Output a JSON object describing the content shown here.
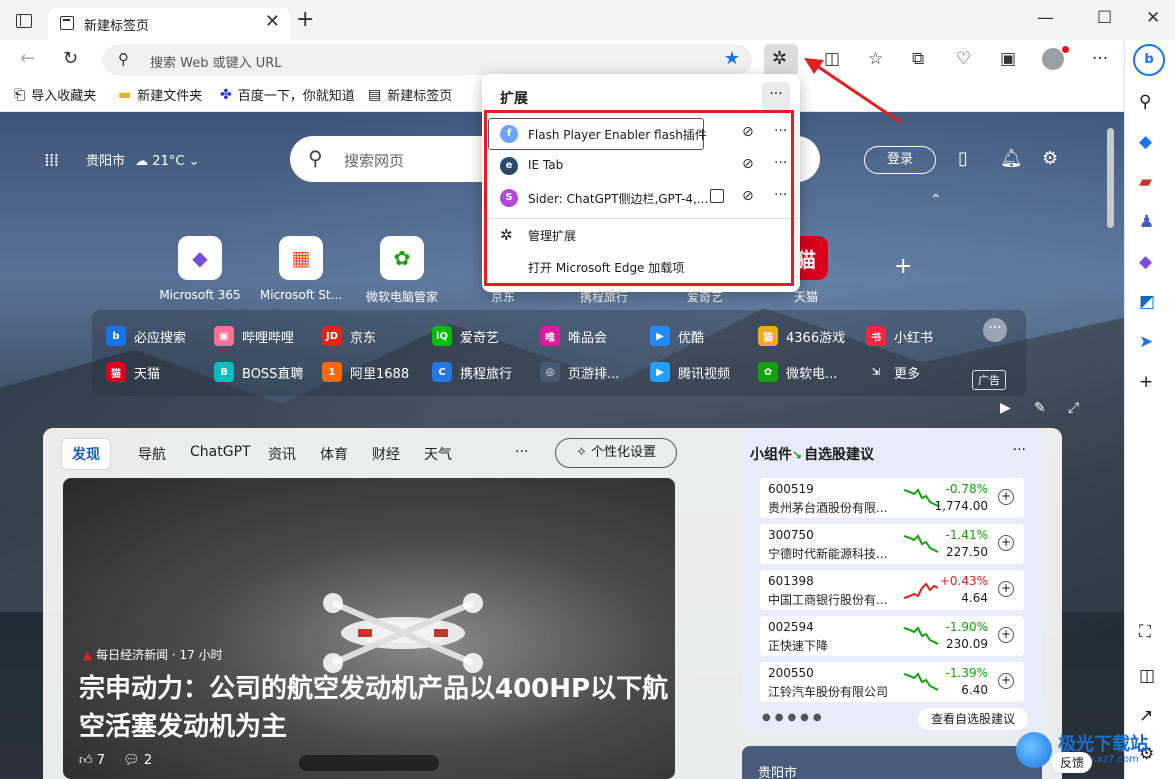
{
  "titlebar": {
    "tab_title": "新建标签页",
    "close_glyph": "✕",
    "new_tab_glyph": "+",
    "minimize": "—",
    "maximize": "☐",
    "close_window": "✕"
  },
  "addressbar": {
    "placeholder": "搜索 Web 或键入 URL"
  },
  "favorites": [
    {
      "label": "导入收藏夹",
      "icon": "import-icon"
    },
    {
      "label": "新建文件夹",
      "icon": "folder-icon"
    },
    {
      "label": "百度一下，你就知道",
      "icon": "baidu-icon"
    },
    {
      "label": "新建标签页",
      "icon": "page-icon"
    }
  ],
  "scene": {
    "city": "贵阳市",
    "temperature": "21°C",
    "search_placeholder": "搜索网页",
    "login": "登录"
  },
  "quick_links": [
    {
      "label": "Microsoft 365",
      "glyph": "◆",
      "color": "#7a4dd8"
    },
    {
      "label": "Microsoft St...",
      "glyph": "▦",
      "color": "#f35325"
    },
    {
      "label": "微软电脑管家",
      "glyph": "✿",
      "color": "#13a10e"
    },
    {
      "label": "京东",
      "glyph": "J",
      "color": "#e1251b"
    },
    {
      "label": "携程旅行",
      "glyph": "C",
      "color": "#2577e3"
    },
    {
      "label": "爱奇艺",
      "glyph": "i",
      "color": "#00be06"
    },
    {
      "label": "天猫",
      "glyph": "猫",
      "color": "#d9001b"
    }
  ],
  "link_strip": {
    "row1": [
      {
        "label": "必应搜索",
        "bg": "#1a73e8",
        "t": "b"
      },
      {
        "label": "哔哩哔哩",
        "bg": "#fb7299",
        "t": "▣"
      },
      {
        "label": "京东",
        "bg": "#e1251b",
        "t": "JD"
      },
      {
        "label": "爱奇艺",
        "bg": "#00be06",
        "t": "iQ"
      },
      {
        "label": "唯品会",
        "bg": "#e2199f",
        "t": "唯"
      },
      {
        "label": "优酷",
        "bg": "#1f8bff",
        "t": "▶"
      },
      {
        "label": "4366游戏",
        "bg": "#f4a91e",
        "t": "猫"
      },
      {
        "label": "小红书",
        "bg": "#ff2442",
        "t": "书"
      }
    ],
    "row2": [
      {
        "label": "天猫",
        "bg": "#d9001b",
        "t": "猫"
      },
      {
        "label": "BOSS直聘",
        "bg": "#00bebd",
        "t": "B"
      },
      {
        "label": "阿里1688",
        "bg": "#ff6a00",
        "t": "1"
      },
      {
        "label": "携程旅行",
        "bg": "#2577e3",
        "t": "C"
      },
      {
        "label": "页游排...",
        "bg": "#4a5a70",
        "t": "◎"
      },
      {
        "label": "腾讯视频",
        "bg": "#20a0ff",
        "t": "▶"
      },
      {
        "label": "微软电...",
        "bg": "#13a10e",
        "t": "✿"
      },
      {
        "label": "更多",
        "bg": "transparent",
        "t": "⇲"
      }
    ],
    "ad": "广告"
  },
  "feed": {
    "tabs": [
      "发现",
      "导航",
      "ChatGPT",
      "资讯",
      "体育",
      "财经",
      "天气"
    ],
    "more": "···",
    "personalize": "个性化设置",
    "hero_source": "每日经济新闻 · 17 小时",
    "hero_title": "宗申动力：公司的航空发动机产品以400HP以下航空活塞发动机为主",
    "likes": "7",
    "comments": "2"
  },
  "widget": {
    "title": "小组件",
    "subtitle": "自选股建议",
    "view_all": "查看自选股建议",
    "stocks": [
      {
        "code": "600519",
        "name": "贵州茅台酒股份有限...",
        "change": "-0.78%",
        "price": "1,774.00",
        "color": "#13a10e"
      },
      {
        "code": "300750",
        "name": "宁德时代新能源科技...",
        "change": "-1.41%",
        "price": "227.50",
        "color": "#13a10e"
      },
      {
        "code": "601398",
        "name": "中国工商银行股份有...",
        "change": "+0.43%",
        "price": "4.64",
        "color": "#e02020"
      },
      {
        "code": "002594",
        "name": "正快速下降",
        "change": "-1.90%",
        "price": "230.09",
        "color": "#13a10e"
      },
      {
        "code": "200550",
        "name": "江铃汽车股份有限公司",
        "change": "-1.39%",
        "price": "6.40",
        "color": "#13a10e"
      }
    ],
    "weather_city": "贵阳市"
  },
  "extensions_popup": {
    "title": "扩展",
    "items": [
      {
        "name": "Flash Player Enabler flash插件",
        "icon_bg": "#6aa5ff",
        "icon_t": "f"
      },
      {
        "name": "IE Tab",
        "icon_bg": "#2b4a6b",
        "icon_t": "e"
      },
      {
        "name": "Sider: ChatGPT侧边栏,GPT-4,...",
        "icon_bg": "#b24ad9",
        "icon_t": "S"
      }
    ],
    "manage": "管理扩展",
    "open_addons": "打开 Microsoft Edge 加载项"
  },
  "watermark": {
    "brand": "极光下载站",
    "url": "www.xz7.com",
    "feedback": "反馈"
  }
}
